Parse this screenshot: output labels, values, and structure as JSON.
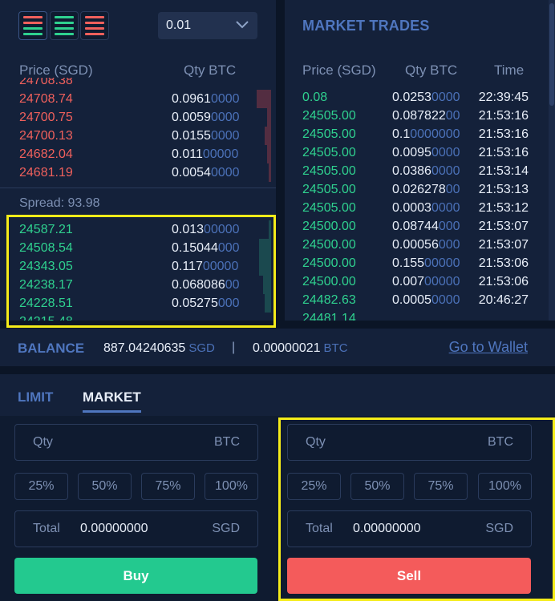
{
  "orderbook": {
    "tick_size": "0.01",
    "headers": {
      "price": "Price (SGD)",
      "qty": "Qty BTC"
    },
    "asks": [
      {
        "price": "24708.74",
        "qty_hi": "0.0961",
        "qty_lo": "0000",
        "depth": 0.07
      },
      {
        "price": "24700.75",
        "qty_hi": "0.0059",
        "qty_lo": "0000",
        "depth": 0.02
      },
      {
        "price": "24700.13",
        "qty_hi": "0.0155",
        "qty_lo": "0000",
        "depth": 0.03
      },
      {
        "price": "24682.04",
        "qty_hi": "0.011",
        "qty_lo": "00000",
        "depth": 0.02
      },
      {
        "price": "24681.19",
        "qty_hi": "0.0054",
        "qty_lo": "0000",
        "depth": 0.01
      }
    ],
    "spread": "Spread: 93.98",
    "bids": [
      {
        "price": "24587.21",
        "qty_hi": "0.013",
        "qty_lo": "00000",
        "depth": 0.01
      },
      {
        "price": "24508.54",
        "qty_hi": "0.15044",
        "qty_lo": "000",
        "depth": 0.06
      },
      {
        "price": "24343.05",
        "qty_hi": "0.117",
        "qty_lo": "00000",
        "depth": 0.06
      },
      {
        "price": "24238.17",
        "qty_hi": "0.068086",
        "qty_lo": "00",
        "depth": 0.04
      },
      {
        "price": "24228.51",
        "qty_hi": "0.05275",
        "qty_lo": "000",
        "depth": 0.03
      }
    ]
  },
  "trades": {
    "title": "MARKET TRADES",
    "headers": {
      "price": "Price (SGD)",
      "qty": "Qty BTC",
      "time": "Time"
    },
    "rows": [
      {
        "price": "0.08",
        "qty_hi": "0.0253",
        "qty_lo": "0000",
        "time": "22:39:45"
      },
      {
        "price": "24505.00",
        "qty_hi": "0.087822",
        "qty_lo": "00",
        "time": "21:53:16"
      },
      {
        "price": "24505.00",
        "qty_hi": "0.1",
        "qty_lo": "0000000",
        "time": "21:53:16"
      },
      {
        "price": "24505.00",
        "qty_hi": "0.0095",
        "qty_lo": "0000",
        "time": "21:53:16"
      },
      {
        "price": "24505.00",
        "qty_hi": "0.0386",
        "qty_lo": "0000",
        "time": "21:53:14"
      },
      {
        "price": "24505.00",
        "qty_hi": "0.026278",
        "qty_lo": "00",
        "time": "21:53:13"
      },
      {
        "price": "24505.00",
        "qty_hi": "0.0003",
        "qty_lo": "0000",
        "time": "21:53:12"
      },
      {
        "price": "24500.00",
        "qty_hi": "0.08744",
        "qty_lo": "000",
        "time": "21:53:07"
      },
      {
        "price": "24500.00",
        "qty_hi": "0.00056",
        "qty_lo": "000",
        "time": "21:53:07"
      },
      {
        "price": "24500.00",
        "qty_hi": "0.155",
        "qty_lo": "00000",
        "time": "21:53:06"
      },
      {
        "price": "24500.00",
        "qty_hi": "0.007",
        "qty_lo": "00000",
        "time": "21:53:06"
      },
      {
        "price": "24482.63",
        "qty_hi": "0.0005",
        "qty_lo": "0000",
        "time": "20:46:27"
      }
    ]
  },
  "balance": {
    "label": "BALANCE",
    "sgd_value": "887.04240635",
    "sgd_unit": "SGD",
    "separator": "|",
    "btc_value": "0.00000021",
    "btc_unit": "BTC",
    "wallet_link": "Go to Wallet"
  },
  "form": {
    "tabs": {
      "limit": "LIMIT",
      "market": "MARKET"
    },
    "active_tab": "MARKET",
    "buy": {
      "qty_label": "Qty",
      "qty_unit": "BTC",
      "pcts": [
        "25%",
        "50%",
        "75%",
        "100%"
      ],
      "total_label": "Total",
      "total_value": "0.00000000",
      "total_unit": "SGD",
      "button": "Buy"
    },
    "sell": {
      "qty_label": "Qty",
      "qty_unit": "BTC",
      "pcts": [
        "25%",
        "50%",
        "75%",
        "100%"
      ],
      "total_label": "Total",
      "total_value": "0.00000000",
      "total_unit": "SGD",
      "button": "Sell"
    }
  },
  "colors": {
    "ask": "#f0605c",
    "bid": "#2fd18f",
    "accent": "#4f76bf",
    "buy": "#23c98f",
    "sell": "#f45b5b",
    "highlight": "#f5ec19"
  }
}
